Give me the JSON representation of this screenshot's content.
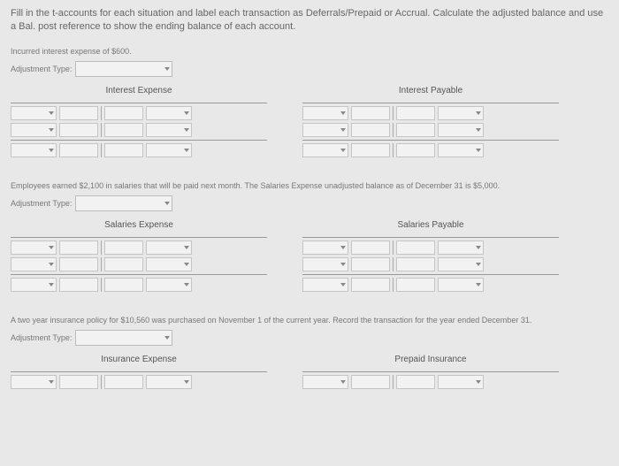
{
  "instructions": "Fill in the t-accounts for each situation and label each transaction as Deferrals/Prepaid or Accrual. Calculate the adjusted balance and use a Bal. post reference to show the ending balance of each account.",
  "adjustment_label": "Adjustment Type:",
  "problems": [
    {
      "text": "Incurred interest expense of $600.",
      "left_title": "Interest Expense",
      "right_title": "Interest Payable"
    },
    {
      "text": "Employees earned $2,100 in salaries that will be paid next month. The Salaries Expense unadjusted balance as of December 31 is $5,000.",
      "left_title": "Salaries Expense",
      "right_title": "Salaries Payable"
    },
    {
      "text": "A two year insurance policy for $10,560 was purchased on November 1 of the current year. Record the transaction for the year ended December 31.",
      "left_title": "Insurance Expense",
      "right_title": "Prepaid Insurance"
    }
  ]
}
